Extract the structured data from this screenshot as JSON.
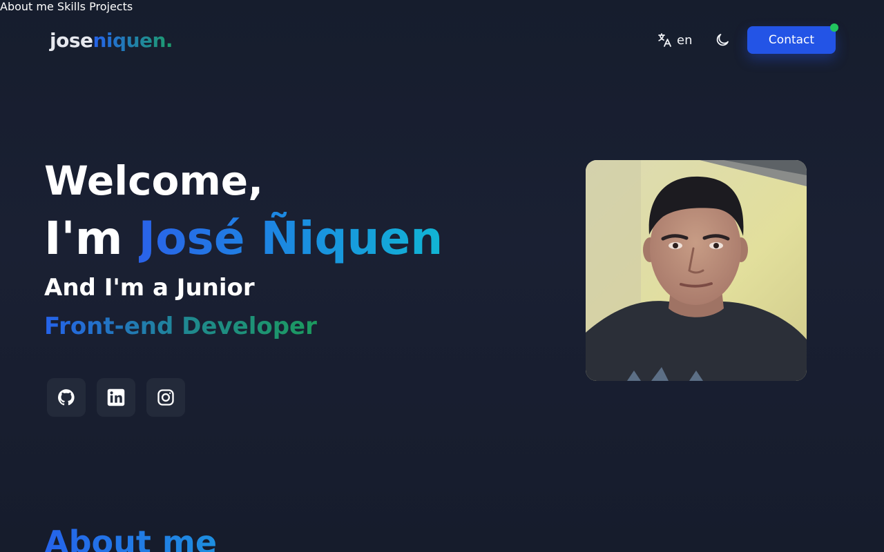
{
  "header": {
    "logo_first": "jose",
    "logo_second": "niquen.",
    "nav": [
      {
        "label": "About me"
      },
      {
        "label": "Skills"
      },
      {
        "label": "Projects"
      }
    ],
    "language": "en",
    "contact_label": "Contact"
  },
  "hero": {
    "welcome": "Welcome,",
    "im": "I'm",
    "name": "José Ñiquen",
    "subtitle": "And I'm a Junior",
    "role": "Front-end Developer",
    "social_icons": [
      "github-icon",
      "linkedin-icon",
      "instagram-icon"
    ]
  },
  "about": {
    "title": "About me"
  },
  "colors": {
    "background": "#161d2d",
    "accent_blue": "#2354e6",
    "gradient_green": "#1c9a5e",
    "gradient_cyan": "#11b5d4",
    "status_green": "#22c55e",
    "social_bg": "#232a3a"
  }
}
